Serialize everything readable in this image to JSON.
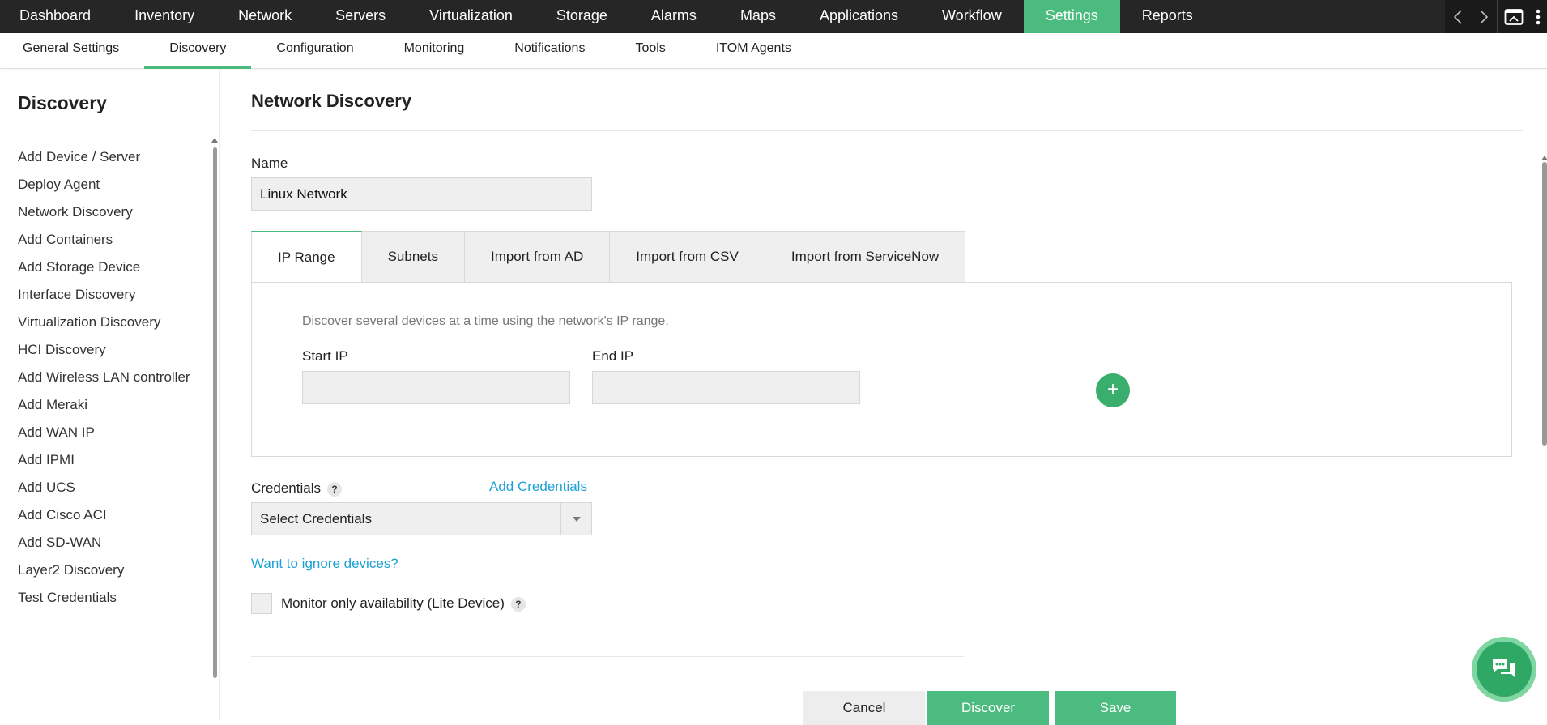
{
  "topnav": {
    "items": [
      "Dashboard",
      "Inventory",
      "Network",
      "Servers",
      "Virtualization",
      "Storage",
      "Alarms",
      "Maps",
      "Applications",
      "Workflow",
      "Settings",
      "Reports"
    ],
    "active": "Settings",
    "controls": [
      "chevron-left-icon",
      "chevron-right-icon",
      "window-icon",
      "more-vertical-icon"
    ]
  },
  "subnav": {
    "items": [
      "General Settings",
      "Discovery",
      "Configuration",
      "Monitoring",
      "Notifications",
      "Tools",
      "ITOM Agents"
    ],
    "active": "Discovery"
  },
  "sidebar": {
    "title": "Discovery",
    "items": [
      "Add Device / Server",
      "Deploy Agent",
      "Network Discovery",
      "Add Containers",
      "Add Storage Device",
      "Interface Discovery",
      "Virtualization Discovery",
      "HCI Discovery",
      "Add Wireless LAN controller",
      "Add Meraki",
      "Add WAN IP",
      "Add IPMI",
      "Add UCS",
      "Add Cisco ACI",
      "Add SD-WAN",
      "Layer2 Discovery",
      "Test Credentials"
    ]
  },
  "main": {
    "title": "Network Discovery",
    "name_label": "Name",
    "name_value": "Linux Network",
    "tabs": [
      "IP Range",
      "Subnets",
      "Import from AD",
      "Import from CSV",
      "Import from ServiceNow"
    ],
    "active_tab": "IP Range",
    "ip_range": {
      "description": "Discover several devices at a time using the network's IP range.",
      "start_label": "Start IP",
      "start_value": "",
      "end_label": "End IP",
      "end_value": "",
      "add_symbol": "+"
    },
    "credentials": {
      "label": "Credentials",
      "help": "?",
      "add_link": "Add Credentials",
      "select_value": "Select Credentials"
    },
    "ignore_link": "Want to ignore devices?",
    "lite_device": {
      "label": "Monitor only availability (Lite Device)",
      "help": "?",
      "checked": false
    },
    "buttons": {
      "cancel": "Cancel",
      "discover": "Discover",
      "save": "Save"
    }
  },
  "colors": {
    "accent": "#4cbb7f",
    "link": "#1ea1d6",
    "topbar": "#262626"
  }
}
